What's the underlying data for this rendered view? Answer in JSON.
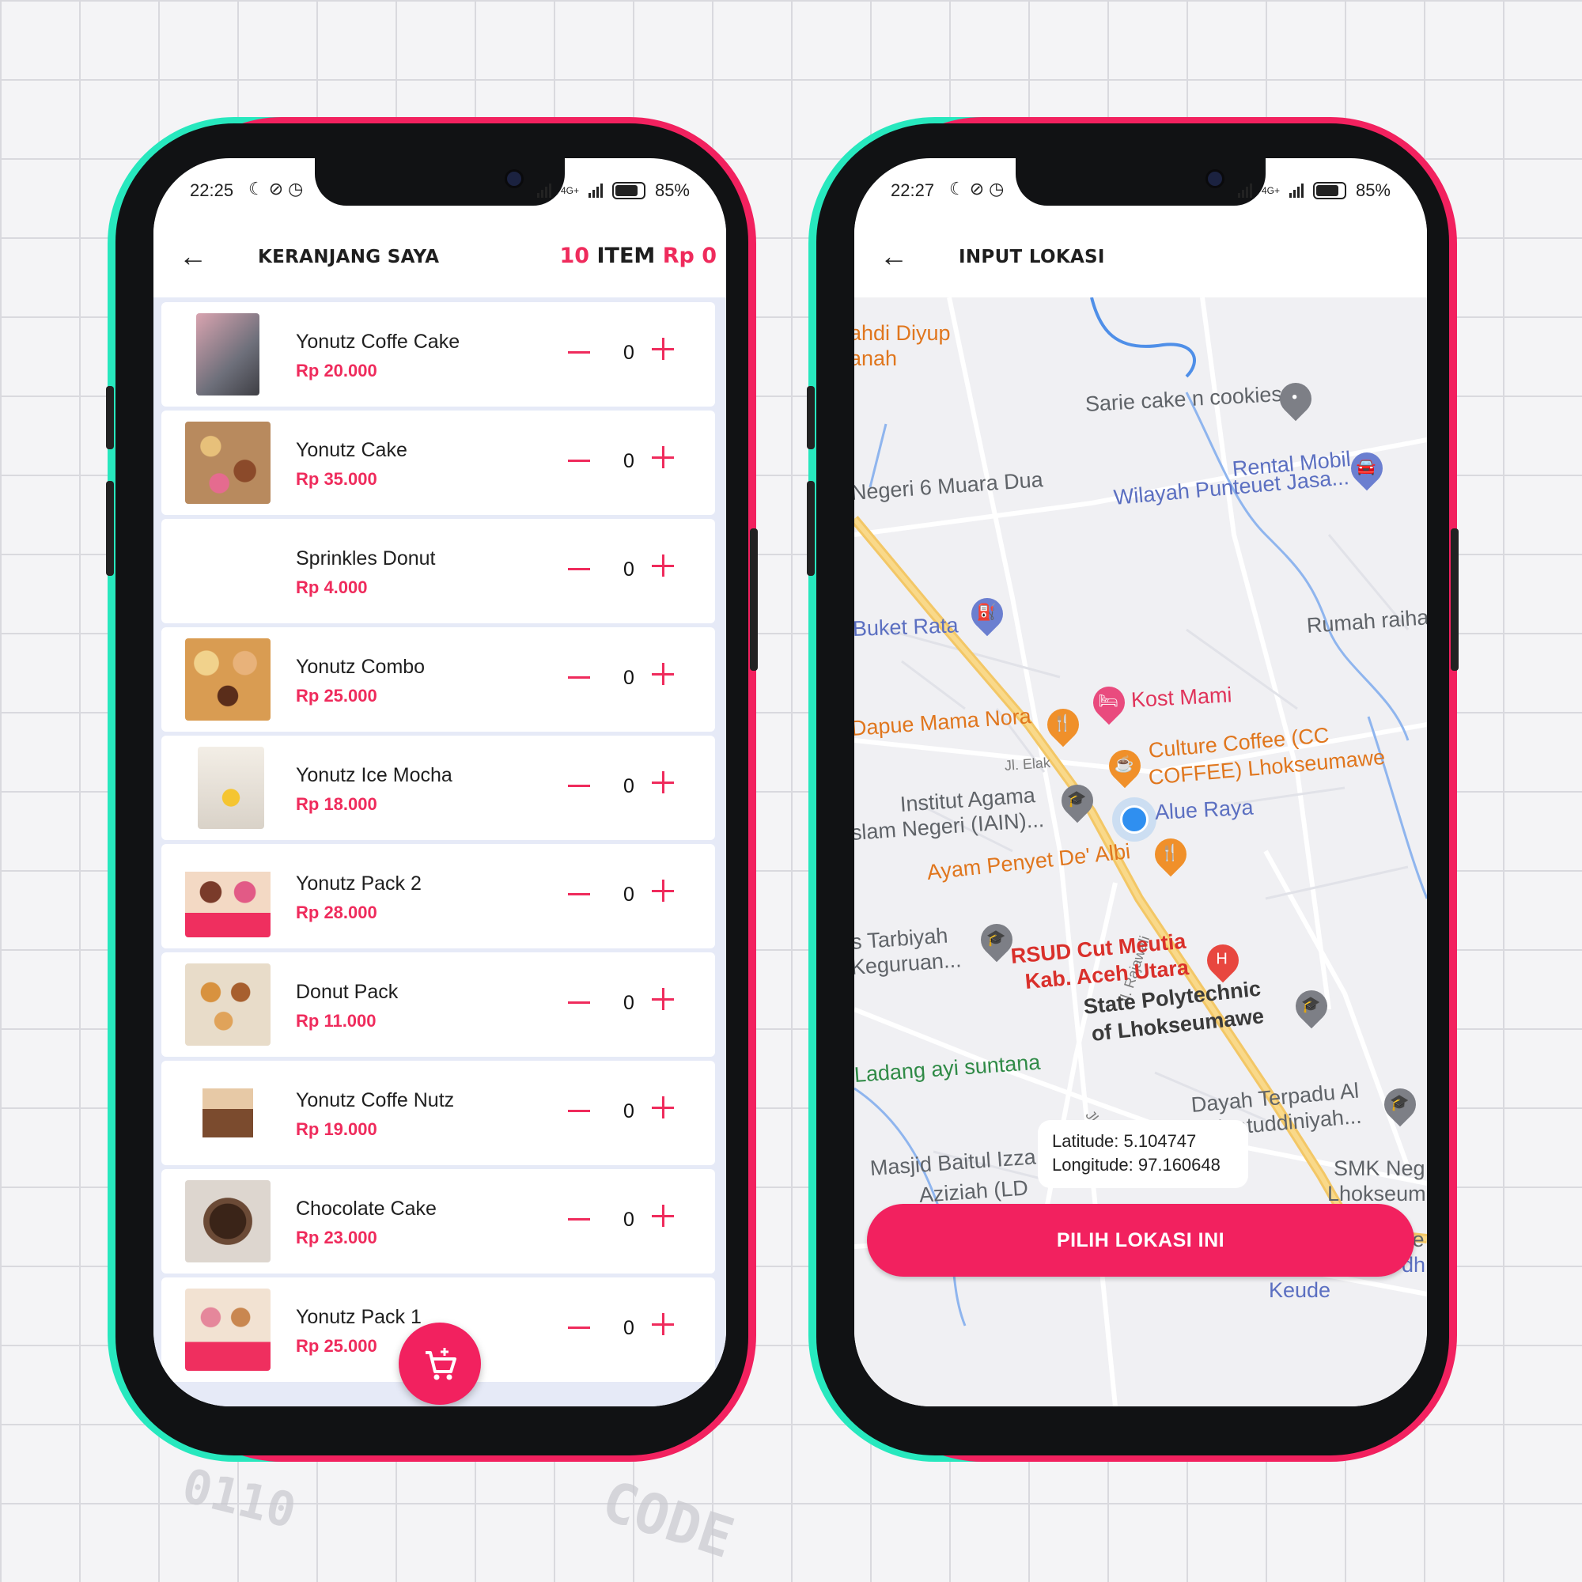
{
  "colors": {
    "accent": "#f2215f",
    "price": "#ef2b5c",
    "teal": "#27e8be"
  },
  "left_phone": {
    "status": {
      "time": "22:25",
      "network": "4G+",
      "battery": "85%"
    },
    "appbar": {
      "title": "KERANJANG SAYA",
      "count_number": "10",
      "count_item": "ITEM",
      "count_total": "Rp 0"
    },
    "items": [
      {
        "name": "Yonutz Coffe Cake",
        "price": "Rp 20.000",
        "qty": "0"
      },
      {
        "name": "Yonutz Cake",
        "price": "Rp 35.000",
        "qty": "0"
      },
      {
        "name": "Sprinkles Donut",
        "price": "Rp 4.000",
        "qty": "0"
      },
      {
        "name": "Yonutz Combo",
        "price": "Rp 25.000",
        "qty": "0"
      },
      {
        "name": "Yonutz Ice Mocha",
        "price": "Rp 18.000",
        "qty": "0"
      },
      {
        "name": "Yonutz Pack 2",
        "price": "Rp 28.000",
        "qty": "0"
      },
      {
        "name": "Donut Pack",
        "price": "Rp 11.000",
        "qty": "0"
      },
      {
        "name": "Yonutz Coffe Nutz",
        "price": "Rp 19.000",
        "qty": "0"
      },
      {
        "name": "Chocolate Cake",
        "price": "Rp 23.000",
        "qty": "0"
      },
      {
        "name": "Yonutz Pack 1",
        "price": "Rp 25.000",
        "qty": "0"
      }
    ],
    "fab_icon": "add-to-cart-icon"
  },
  "right_phone": {
    "status": {
      "time": "22:27",
      "network": "4G+",
      "battery": "85%"
    },
    "appbar": {
      "title": "INPUT LOKASI"
    },
    "map_labels": {
      "diyup1": "ahdi Diyup",
      "diyup2": "anah",
      "sarie": "Sarie cake n cookies",
      "rental1": "Rental Mobil",
      "rental2": "Wilayah Punteuet Jasa...",
      "negeri6": "Negeri 6 Muara Dua",
      "buket": "Buket Rata",
      "rumah": "Rumah raiha",
      "kost": "Kost Mami",
      "dapue": "Dapue Mama Nora",
      "jl_elak": "Jl. Elak",
      "culture1": "Culture Coffee (CC",
      "culture2": "COFFEE) Lhokseumawe",
      "iain1": "Institut Agama",
      "iain2": "slam Negeri (IAIN)...",
      "alue": "Alue Raya",
      "ayam": "Ayam Penyet De' Albi",
      "rajawali": "Jl. Rajawali",
      "tarbiyah1": "s Tarbiyah",
      "tarbiyah2": "Keguruan...",
      "rsud1": "RSUD Cut Meutia",
      "rsud2": "Kab. Aceh Utara",
      "poly1": "State Polytechnic",
      "poly2": "of Lhokseumawe",
      "ladang": "Ladang ayi suntana",
      "rajaw2": "Jl. Rajaw",
      "dayah1": "Dayah Terpadu Al",
      "dayah2": "Madinatuddiniyah...",
      "masjid1": "Masjid Baitul Izza",
      "masjid2": "Aziziah (LD",
      "smk1": "SMK Neg",
      "smk2": "Lhokseum",
      "ke": "ke",
      "keude": "Keude",
      "dh": "dh"
    },
    "coords": {
      "lat": "Latitude: 5.104747",
      "lng": "Longitude: 97.160648"
    },
    "pick_button": "PILIH LOKASI INI"
  }
}
